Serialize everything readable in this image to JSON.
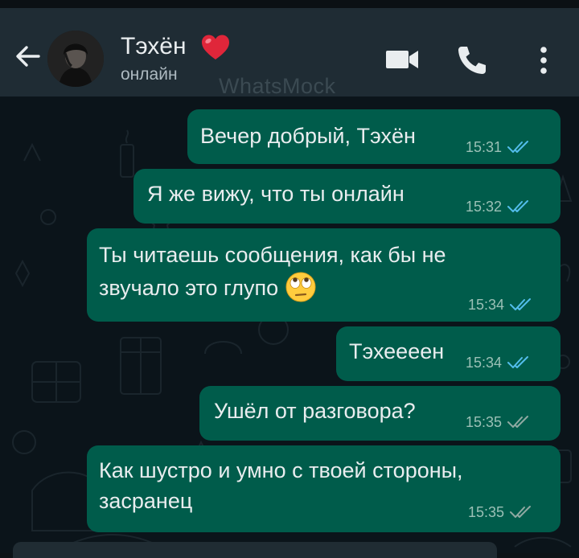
{
  "header": {
    "contact_name": "Тэхён",
    "status": "онлайн",
    "watermark": "WhatsMock",
    "icons": [
      "back-arrow-icon",
      "avatar",
      "heart-icon",
      "video-call-icon",
      "phone-call-icon",
      "more-options-icon"
    ]
  },
  "messages": [
    {
      "lines": [
        "Вечер добрый, Тэхён"
      ],
      "time": "15:31",
      "read": true
    },
    {
      "lines": [
        "Я же вижу, что ты онлайн"
      ],
      "time": "15:32",
      "read": true
    },
    {
      "lines": [
        "Ты читаешь сообщения, как бы не",
        "звучало это глупо"
      ],
      "emoji": "face-with-rolling-eyes-icon",
      "time": "15:34",
      "read": true
    },
    {
      "lines": [
        "Тэхеееен"
      ],
      "time": "15:34",
      "read": true
    },
    {
      "lines": [
        "Ушёл от разговора?"
      ],
      "time": "15:35",
      "read": false
    },
    {
      "lines": [
        "Как шустро и умно с твоей стороны,",
        "засранец"
      ],
      "time": "15:35",
      "read": false
    }
  ],
  "colors": {
    "header_bg": "#1f2c34",
    "chat_bg": "#0b141a",
    "outgoing_bubble": "#005c4b",
    "read_tick": "#53bdeb",
    "unread_tick": "#8fa9a2",
    "heart": "#e0263a"
  }
}
